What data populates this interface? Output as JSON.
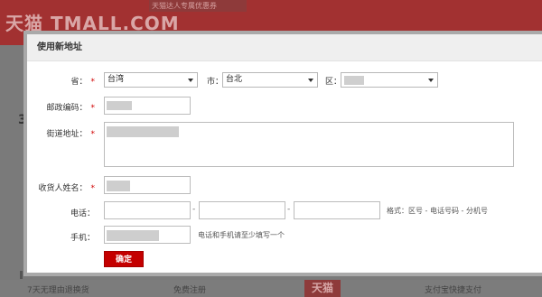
{
  "background": {
    "logo": "天猫 TMALL.COM",
    "banner": "天猫达人专属优惠券",
    "left_text": "3",
    "footer": {
      "left": "7天无理由退换货",
      "middle": "免费注册",
      "logo": "天猫",
      "right": "支付宝快捷支付"
    }
  },
  "modal": {
    "title": "使用新地址",
    "province": {
      "label": "省：",
      "value": "台湾"
    },
    "city": {
      "label": "市：",
      "value": "台北"
    },
    "district": {
      "label": "区："
    },
    "postcode": {
      "label": "邮政编码："
    },
    "street": {
      "label": "街道地址："
    },
    "receiver": {
      "label": "收货人姓名："
    },
    "phone": {
      "label": "电话：",
      "sep": "-",
      "hint": "格式：区号 - 电话号码 - 分机号"
    },
    "mobile": {
      "label": "手机：",
      "hint": "电话和手机请至少填写一个"
    },
    "required_mark": "*",
    "confirm_label": "确定"
  }
}
